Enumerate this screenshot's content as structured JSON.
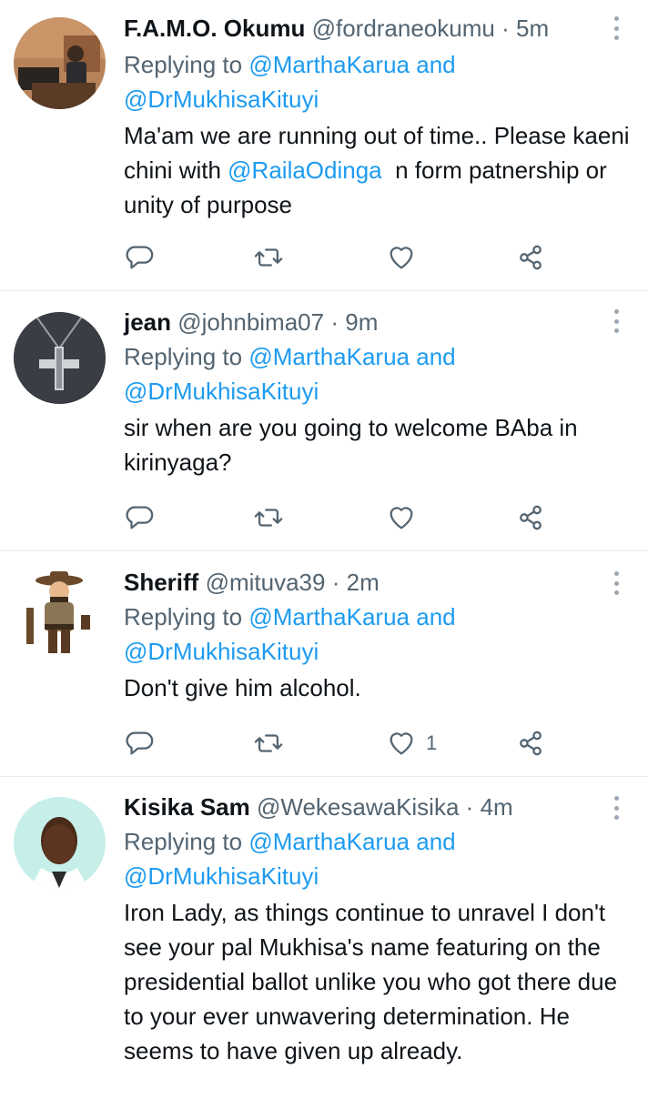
{
  "tweets": [
    {
      "name": "F.A.M.O. Okumu",
      "handle": "@fordraneokumu",
      "time": "5m",
      "replying_prefix": "Replying to",
      "reply_mention_1": "@MarthaKarua",
      "reply_and": "and",
      "reply_mention_2": "@DrMukhisaKituyi",
      "text_part1": "Ma'am we are running out of time.. Please kaeni chini with ",
      "text_mention": "@RailaOdinga",
      "text_part2": "  n form patnership or unity of purpose",
      "like_count": ""
    },
    {
      "name": "jean",
      "handle": "@johnbima07",
      "time": "9m",
      "replying_prefix": "Replying to",
      "reply_mention_1": "@MarthaKarua",
      "reply_and": "and",
      "reply_mention_2": "@DrMukhisaKituyi",
      "text": "sir when are you going to welcome BAba in kirinyaga?",
      "like_count": ""
    },
    {
      "name": "Sheriff",
      "handle": "@mituva39",
      "time": "2m",
      "replying_prefix": "Replying to",
      "reply_mention_1": "@MarthaKarua",
      "reply_and": "and",
      "reply_mention_2": "@DrMukhisaKituyi",
      "text": "Don't give him alcohol.",
      "like_count": "1"
    },
    {
      "name": "Kisika Sam",
      "handle": "@WekesawaKisika",
      "time": "4m",
      "replying_prefix": "Replying to",
      "reply_mention_1": "@MarthaKarua",
      "reply_and": "and",
      "reply_mention_2": "@DrMukhisaKituyi",
      "text": "Iron Lady, as things continue to unravel I don't see your pal Mukhisa's name featuring on the presidential ballot unlike you who got there due to your ever unwavering determination. He seems to have given up already.",
      "like_count": ""
    }
  ],
  "avatars": [
    "person-at-desk-photo",
    "jesus-cross-pendant-photo",
    "cartoon-sheriff-avatar",
    "man-portrait-photo"
  ],
  "colors": {
    "mention": "#1d9bf0",
    "secondary_text": "#536471",
    "primary_text": "#0f1419",
    "divider": "#e6ecf0",
    "icon": "#536471"
  }
}
